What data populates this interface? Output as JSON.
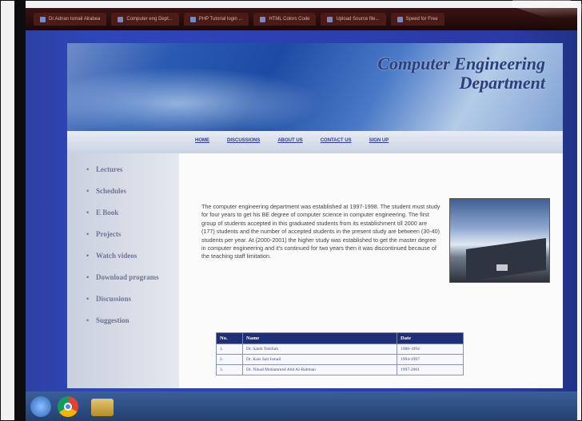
{
  "browser": {
    "tabs": [
      {
        "label": "Dr.Adnan Ismail Alrabea"
      },
      {
        "label": "Computer eng Dept..."
      },
      {
        "label": "PHP Tutorial login ..."
      },
      {
        "label": "HTML Colors Code"
      },
      {
        "label": "Upload Source file..."
      },
      {
        "label": "Speed for Free"
      }
    ]
  },
  "site": {
    "title_line1": "Computer Engineering",
    "title_line2": "Department",
    "nav": [
      "HOME",
      "DISCUSSIONS",
      "ABOUT US",
      "CONTACT US",
      "SIGN UP"
    ],
    "sidebar": [
      "Lectures",
      "Schedules",
      "E Book",
      "Projects",
      "Watch videos",
      "Download programs",
      "Discussions",
      "Suggestion"
    ],
    "intro": "The computer engineering department was established at 1997-1998. The student must study for four years to get his BE degree of computer science in computer engineering. The first group of students accepted in this graduated students from its establishment till 2000 are (177) students and the number of accepted students in the present study are between (30-40) students per year. At (2000-2001) the higher study was established to get the master degree in computer engineering and it's continued for two years then it was discontinued because of the teaching staff limitation.",
    "table": {
      "headers": [
        "No.",
        "Name",
        "Date"
      ],
      "rows": [
        [
          "1.",
          "Dr. Saleh Tobillah",
          "1988-1994"
        ],
        [
          "2.",
          "Dr. Kais Sait Ismail",
          "1994-1997"
        ],
        [
          "3.",
          "Dr. Nihad Mohammed Abd Al-Rahman",
          "1997-2001"
        ]
      ]
    }
  }
}
